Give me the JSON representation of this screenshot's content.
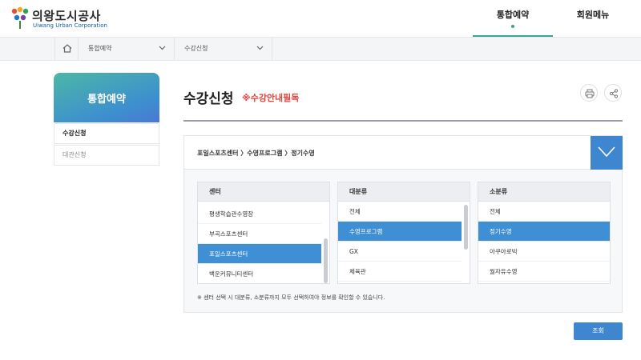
{
  "header": {
    "logo_title": "의왕도시공사",
    "logo_subtitle": "Uiwang Urban Corporation",
    "nav": [
      {
        "label": "통합예약"
      },
      {
        "label": "회원메뉴"
      }
    ]
  },
  "breadcrumb": {
    "home_icon": "home-icon",
    "items": [
      {
        "label": "통합예약"
      },
      {
        "label": "수강신청"
      }
    ]
  },
  "sidebar": {
    "title": "통합예약",
    "items": [
      {
        "label": "수강신청"
      },
      {
        "label": "대관신청"
      }
    ]
  },
  "main": {
    "title": "수강신청",
    "notice": "※수강안내필독",
    "path": "포일스포츠센터 〉수영프로그램 〉정기수영",
    "columns": [
      {
        "header": "센터",
        "options": [
          "평생학습관수영장",
          "부곡스포츠센터",
          "포일스포츠센터",
          "백운커뮤니티센터"
        ],
        "selected": "포일스포츠센터"
      },
      {
        "header": "대분류",
        "options": [
          "전체",
          "수영프로그램",
          "GX",
          "체육관"
        ],
        "selected": "수영프로그램"
      },
      {
        "header": "소분류",
        "options": [
          "전체",
          "정기수영",
          "아쿠아로빅",
          "월자유수영"
        ],
        "selected": "정기수영"
      }
    ],
    "note": "※ 센터 선택 시 대분류, 소분류까지 모두 선택하여야 정보를 확인할 수 있습니다.",
    "search_label": "조회"
  },
  "colors": {
    "accent": "#3e86cf",
    "brand_teal": "#3aa39a",
    "notice_red": "#e2413a"
  }
}
